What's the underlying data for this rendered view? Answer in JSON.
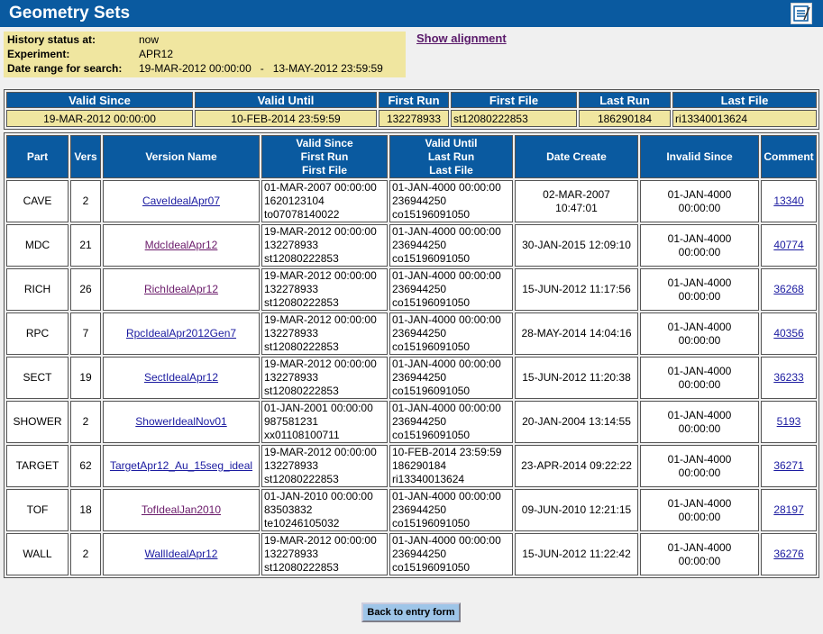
{
  "page": {
    "title": "Geometry Sets"
  },
  "history": {
    "status_label": "History status at:",
    "status_value": "now",
    "experiment_label": "Experiment:",
    "experiment_value": "APR12",
    "range_label": "Date range for search:",
    "range_value": "19-MAR-2012 00:00:00   -   13-MAY-2012 23:59:59"
  },
  "show_alignment": "Show alignment",
  "summary": {
    "headers": [
      "Valid Since",
      "Valid Until",
      "First Run",
      "First File",
      "Last Run",
      "Last File"
    ],
    "values": [
      "19-MAR-2012 00:00:00",
      "10-FEB-2014 23:59:59",
      "132278933",
      "st12080222853",
      "186290184",
      "ri13340013624"
    ]
  },
  "table": {
    "headers": {
      "part": "Part",
      "vers": "Vers",
      "version_name": "Version Name",
      "valid_since": [
        "Valid Since",
        "First Run",
        "First File"
      ],
      "valid_until": [
        "Valid Until",
        "Last Run",
        "Last File"
      ],
      "date_create": "Date Create",
      "invalid_since": "Invalid Since",
      "comment": "Comment"
    },
    "rows": [
      {
        "part": "CAVE",
        "vers": "2",
        "name": "CaveIdealApr07",
        "since": [
          "01-MAR-2007 00:00:00",
          "1620123104",
          "to07078140022"
        ],
        "until": [
          "01-JAN-4000 00:00:00",
          "236944250",
          "co15196091050"
        ],
        "create": [
          "02-MAR-2007",
          "10:47:01"
        ],
        "invalid": [
          "01-JAN-4000",
          "00:00:00"
        ],
        "comment": "13340"
      },
      {
        "part": "MDC",
        "vers": "21",
        "name": "MdcIdealApr12",
        "since": [
          "19-MAR-2012 00:00:00",
          "132278933",
          "st12080222853"
        ],
        "until": [
          "01-JAN-4000 00:00:00",
          "236944250",
          "co15196091050"
        ],
        "create": [
          "30-JAN-2015 12:09:10"
        ],
        "invalid": [
          "01-JAN-4000",
          "00:00:00"
        ],
        "comment": "40774"
      },
      {
        "part": "RICH",
        "vers": "26",
        "name": "RichIdealApr12",
        "since": [
          "19-MAR-2012 00:00:00",
          "132278933",
          "st12080222853"
        ],
        "until": [
          "01-JAN-4000 00:00:00",
          "236944250",
          "co15196091050"
        ],
        "create": [
          "15-JUN-2012 11:17:56"
        ],
        "invalid": [
          "01-JAN-4000",
          "00:00:00"
        ],
        "comment": "36268"
      },
      {
        "part": "RPC",
        "vers": "7",
        "name": "RpcIdealApr2012Gen7",
        "since": [
          "19-MAR-2012 00:00:00",
          "132278933",
          "st12080222853"
        ],
        "until": [
          "01-JAN-4000 00:00:00",
          "236944250",
          "co15196091050"
        ],
        "create": [
          "28-MAY-2014 14:04:16"
        ],
        "invalid": [
          "01-JAN-4000",
          "00:00:00"
        ],
        "comment": "40356"
      },
      {
        "part": "SECT",
        "vers": "19",
        "name": "SectIdealApr12",
        "since": [
          "19-MAR-2012 00:00:00",
          "132278933",
          "st12080222853"
        ],
        "until": [
          "01-JAN-4000 00:00:00",
          "236944250",
          "co15196091050"
        ],
        "create": [
          "15-JUN-2012 11:20:38"
        ],
        "invalid": [
          "01-JAN-4000",
          "00:00:00"
        ],
        "comment": "36233"
      },
      {
        "part": "SHOWER",
        "vers": "2",
        "name": "ShowerIdealNov01",
        "since": [
          "01-JAN-2001 00:00:00",
          "987581231",
          "xx01108100711"
        ],
        "until": [
          "01-JAN-4000 00:00:00",
          "236944250",
          "co15196091050"
        ],
        "create": [
          "20-JAN-2004 13:14:55"
        ],
        "invalid": [
          "01-JAN-4000",
          "00:00:00"
        ],
        "comment": "5193"
      },
      {
        "part": "TARGET",
        "vers": "62",
        "name": "TargetApr12_Au_15seg_ideal",
        "since": [
          "19-MAR-2012 00:00:00",
          "132278933",
          "st12080222853"
        ],
        "until": [
          "10-FEB-2014 23:59:59",
          "186290184",
          "ri13340013624"
        ],
        "create": [
          "23-APR-2014 09:22:22"
        ],
        "invalid": [
          "01-JAN-4000",
          "00:00:00"
        ],
        "comment": "36271"
      },
      {
        "part": "TOF",
        "vers": "18",
        "name": "TofIdealJan2010",
        "since": [
          "01-JAN-2010 00:00:00",
          "83503832",
          "te10246105032"
        ],
        "until": [
          "01-JAN-4000 00:00:00",
          "236944250",
          "co15196091050"
        ],
        "create": [
          "09-JUN-2010 12:21:15"
        ],
        "invalid": [
          "01-JAN-4000",
          "00:00:00"
        ],
        "comment": "28197"
      },
      {
        "part": "WALL",
        "vers": "2",
        "name": "WallIdealApr12",
        "since": [
          "19-MAR-2012 00:00:00",
          "132278933",
          "st12080222853"
        ],
        "until": [
          "01-JAN-4000 00:00:00",
          "236944250",
          "co15196091050"
        ],
        "create": [
          "15-JUN-2012 11:22:42"
        ],
        "invalid": [
          "01-JAN-4000",
          "00:00:00"
        ],
        "comment": "36276"
      }
    ]
  },
  "back_button": "Back to entry form"
}
